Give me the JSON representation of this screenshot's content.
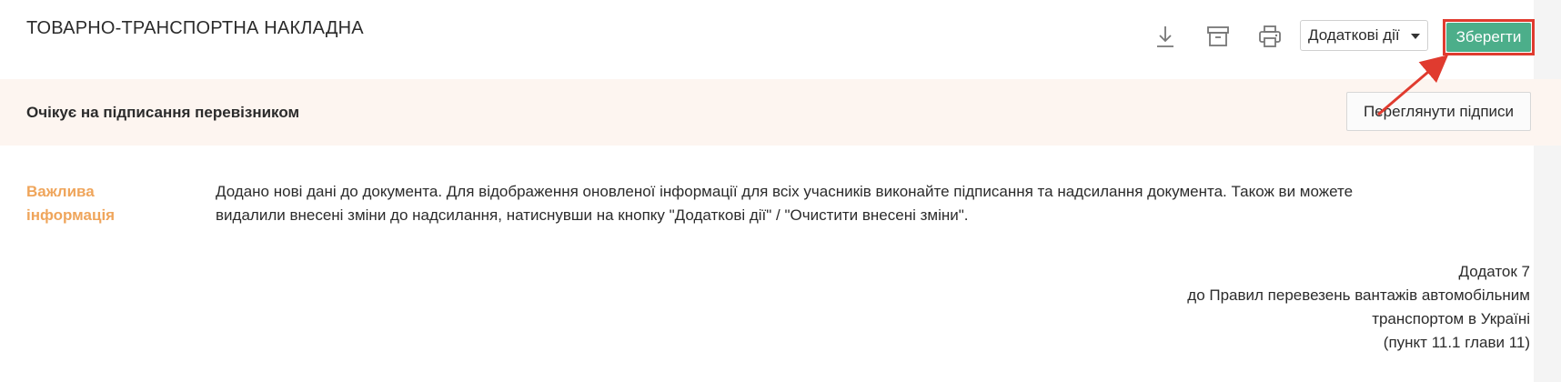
{
  "header": {
    "title": "ТОВАРНО-ТРАНСПОРТНА НАКЛАДНА",
    "actions_dropdown": "Додаткові дії",
    "save_label": "Зберегти",
    "icons": [
      "download-icon",
      "archive-icon",
      "print-icon"
    ]
  },
  "status": {
    "text": "Очікує на підписання перевізником",
    "view_signatures": "Переглянути підписи"
  },
  "notice": {
    "label_line1": "Важлива",
    "label_line2": "інформація",
    "line1": "Додано нові дані до документа. Для відображення оновленої інформації для всіх учасників виконайте підписання та надсилання документа. Також ви можете",
    "line2": "видалили внесені зміни до надсилання, натиснувши на кнопку \"Додаткові дії\" / \"Очистити внесені зміни\".",
    "label_color": "#efa55b"
  },
  "appendix": {
    "lines": [
      "Додаток 7",
      "до Правил перевезень вантажів автомобільним",
      "транспортом в Україні",
      "(пункт 11.1 глави 11)"
    ]
  },
  "colors": {
    "save_bg": "#4cae8a",
    "highlight": "#e03b2f",
    "status_bg": "#fdf5f0"
  }
}
